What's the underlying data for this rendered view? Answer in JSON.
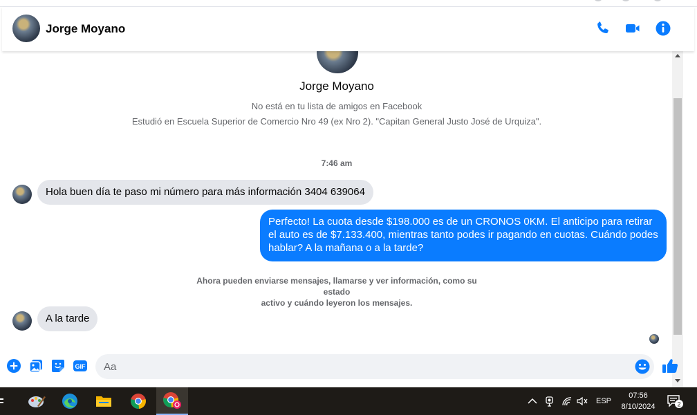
{
  "contact": {
    "name": "Jorge Moyano",
    "friend_status": "No está en tu lista de amigos en Facebook",
    "education": "Estudió en Escuela Superior de Comercio Nro 49 (ex Nro 2). \"Capitan General Justo José de Urquiza\"."
  },
  "header": {
    "call_icon": "phone-icon",
    "video_icon": "video-camera-icon",
    "info_icon": "info-icon",
    "accent_color": "#0a7cff"
  },
  "conversation": {
    "timestamp": "7:46 am",
    "messages": [
      {
        "direction": "incoming",
        "text": "Hola buen día te paso mi número para más información 3404 639064"
      },
      {
        "direction": "outgoing",
        "text": "Perfecto! La cuota desde $198.000 es de un CRONOS 0KM. El anticipo para retirar el auto es de $7.133.400, mientras tanto podes ir pagando en cuotas. Cuándo podes hablar? A la mañana o a la tarde?"
      },
      {
        "direction": "incoming",
        "text": "A la tarde"
      }
    ],
    "notice_line1": "Ahora pueden enviarse mensajes, llamarse y ver información, como su estado",
    "notice_line2": "activo y cuándo leyeron los mensajes."
  },
  "composer": {
    "placeholder": "Aa",
    "gif_label": "GIF",
    "icons": [
      "plus-icon",
      "image-icon",
      "sticker-icon",
      "gif-icon",
      "emoji-icon",
      "like-icon"
    ]
  },
  "taskbar": {
    "apps": [
      "paint-app-icon",
      "edge-icon",
      "file-explorer-icon",
      "chrome-icon",
      "chrome-profile-icon"
    ],
    "language": "ESP",
    "time": "07:56",
    "date": "8/10/2024",
    "notification_count": "2"
  }
}
